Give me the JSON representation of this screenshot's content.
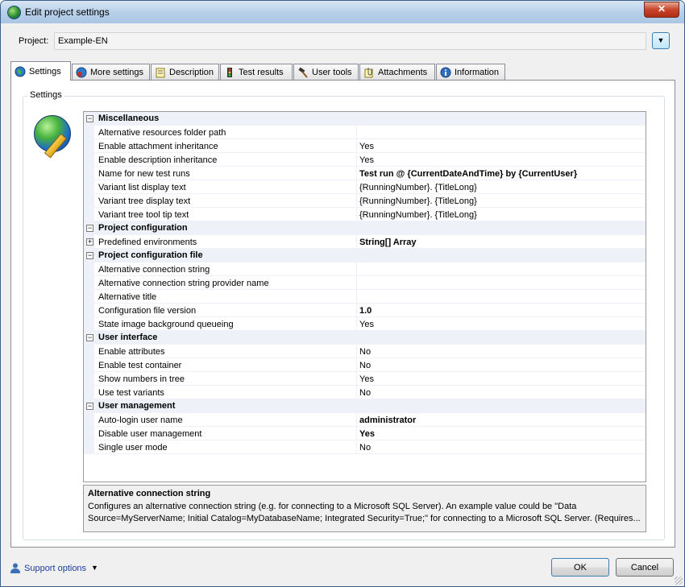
{
  "window": {
    "title": "Edit project settings",
    "close_glyph": "✕"
  },
  "project": {
    "label": "Project:",
    "value": "Example-EN",
    "dropdown_glyph": "▼"
  },
  "tabs": [
    {
      "label": "Settings",
      "icon": "globe-icon",
      "active": true
    },
    {
      "label": "More settings",
      "icon": "globe-gear-icon"
    },
    {
      "label": "Description",
      "icon": "notepad-icon"
    },
    {
      "label": "Test results",
      "icon": "traffic-light-icon"
    },
    {
      "label": "User tools",
      "icon": "hammer-icon"
    },
    {
      "label": "Attachments",
      "icon": "paperclip-icon"
    },
    {
      "label": "Information",
      "icon": "info-icon"
    }
  ],
  "group_label": "Settings",
  "categories": [
    {
      "name": "Miscellaneous",
      "expander": "−",
      "props": [
        {
          "name": "Alternative resources folder path",
          "value": ""
        },
        {
          "name": "Enable attachment inheritance",
          "value": "Yes"
        },
        {
          "name": "Enable description inheritance",
          "value": "Yes"
        },
        {
          "name": "Name for new test runs",
          "value": "Test run @ {CurrentDateAndTime} by {CurrentUser}",
          "bold": true
        },
        {
          "name": "Variant list display text",
          "value": "{RunningNumber}. {TitleLong}"
        },
        {
          "name": "Variant tree display text",
          "value": "{RunningNumber}. {TitleLong}"
        },
        {
          "name": "Variant tree tool tip text",
          "value": "{RunningNumber}. {TitleLong}"
        }
      ]
    },
    {
      "name": "Project configuration",
      "expander": "−",
      "props": [
        {
          "name": "Predefined environments",
          "value": "String[] Array",
          "bold": true,
          "expander": "+"
        }
      ]
    },
    {
      "name": "Project configuration file",
      "expander": "−",
      "props": [
        {
          "name": "Alternative connection string",
          "value": ""
        },
        {
          "name": "Alternative connection string provider name",
          "value": ""
        },
        {
          "name": "Alternative title",
          "value": ""
        },
        {
          "name": "Configuration file version",
          "value": "1.0",
          "bold": true
        },
        {
          "name": "State image background queueing",
          "value": "Yes"
        }
      ]
    },
    {
      "name": "User interface",
      "expander": "−",
      "props": [
        {
          "name": "Enable attributes",
          "value": "No"
        },
        {
          "name": "Enable test container",
          "value": "No"
        },
        {
          "name": "Show numbers in tree",
          "value": "Yes"
        },
        {
          "name": "Use test variants",
          "value": "No"
        }
      ]
    },
    {
      "name": "User management",
      "expander": "−",
      "props": [
        {
          "name": "Auto-login user name",
          "value": "administrator",
          "bold": true
        },
        {
          "name": "Disable user management",
          "value": "Yes",
          "bold": true
        },
        {
          "name": "Single user mode",
          "value": "No"
        }
      ]
    }
  ],
  "description": {
    "title": "Alternative connection string",
    "text": "Configures an alternative connection string (e.g. for connecting to a Microsoft SQL Server). An example value could be \"Data Source=MyServerName; Initial Catalog=MyDatabaseName; Integrated Security=True;\" for connecting to a Microsoft SQL Server. (Requires..."
  },
  "footer": {
    "support_label": "Support options",
    "support_arrow": "▼",
    "ok_label": "OK",
    "cancel_label": "Cancel"
  }
}
